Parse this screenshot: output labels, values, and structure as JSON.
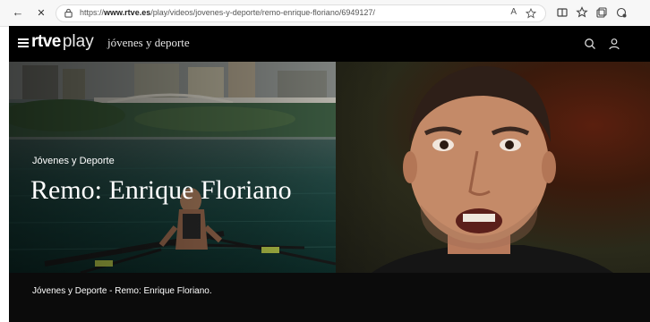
{
  "browser": {
    "back_glyph": "←",
    "close_glyph": "✕",
    "url_prefix": "https://",
    "url_host": "www.rtve.es",
    "url_path": "/play/videos/jovenes-y-deporte/remo-enrique-floriano/6949127/",
    "read_aloud_glyph": "A"
  },
  "header": {
    "logo_main": "rtve",
    "logo_sub": "play",
    "section_link": "jóvenes y deporte"
  },
  "hero": {
    "kicker": "Jóvenes y Deporte",
    "title": "Remo: Enrique Floriano"
  },
  "description": "Jóvenes y Deporte - Remo: Enrique Floriano.",
  "colors": {
    "page_bg": "#0b0b0b",
    "header_bg": "#000000",
    "text": "#ffffff"
  }
}
